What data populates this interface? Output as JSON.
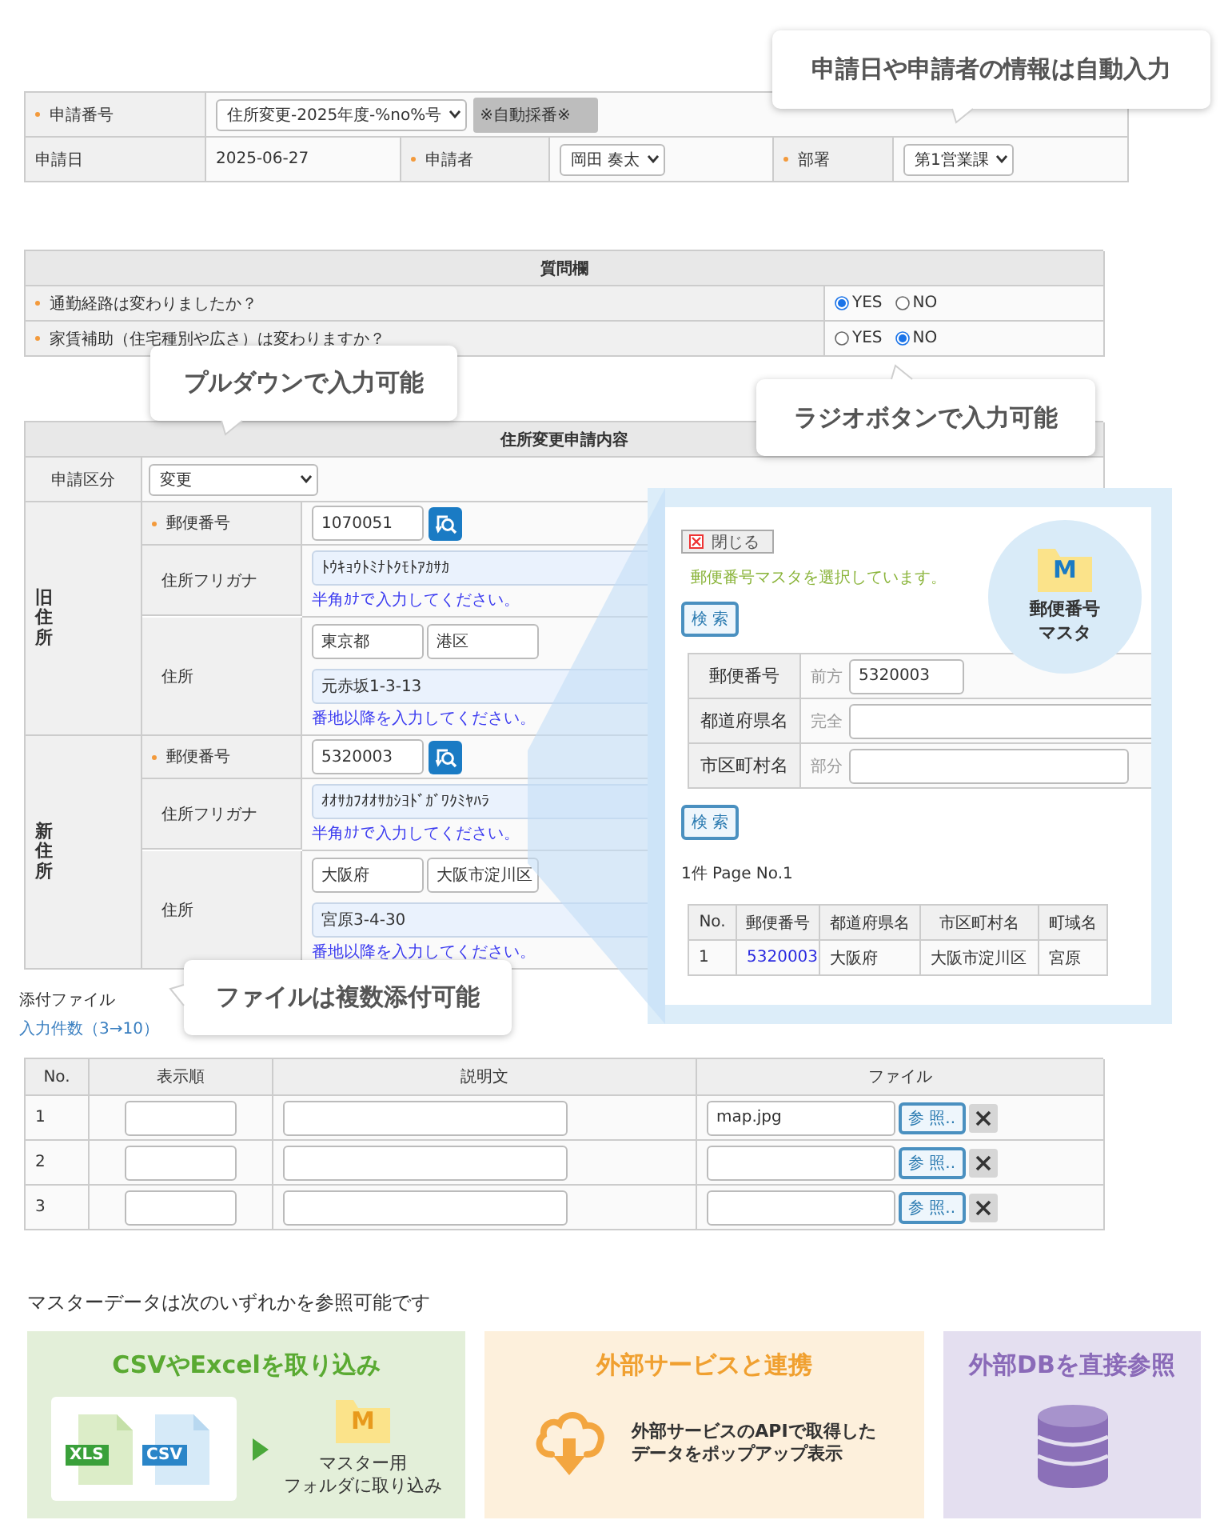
{
  "callouts": [
    {
      "text": "申請日や申請者の情報は自動入力"
    },
    {
      "text": "プルダウンで入力可能"
    },
    {
      "text": "ラジオボタンで入力可能"
    },
    {
      "text": "ファイルは複数添付可能"
    }
  ],
  "application": {
    "fields": [
      {
        "label": "申請番号",
        "required": true,
        "kind": "select",
        "value": "住所変更-2025年度-%no%号",
        "badge": "※自動採番※"
      },
      {
        "label": "申請日",
        "kind": "text",
        "value": "2025-06-27"
      },
      {
        "label": "申請者",
        "required": true,
        "kind": "select",
        "value": "岡田 奏太"
      },
      {
        "label": "部署",
        "required": true,
        "kind": "select",
        "value": "第1営業課"
      }
    ]
  },
  "questions": {
    "title": "質問欄",
    "items": [
      {
        "label": "通勤経路は変わりましたか？",
        "required": true,
        "options": [
          {
            "label": "YES",
            "selected": true
          },
          {
            "label": "NO",
            "selected": false
          }
        ]
      },
      {
        "label": "家賃補助（住宅種別や広さ）は変わりますか？",
        "required": true,
        "options": [
          {
            "label": "YES",
            "selected": false
          },
          {
            "label": "NO",
            "selected": true
          }
        ]
      }
    ]
  },
  "address_change": {
    "title": "住所変更申請内容",
    "category": {
      "label": "申請区分",
      "value": "変更"
    },
    "groups": [
      {
        "label": "旧住所",
        "postal": {
          "label": "郵便番号",
          "required": true,
          "value": "1070051"
        },
        "furigana": {
          "label": "住所フリガナ",
          "value": "ﾄｳｷｮｳﾄﾐﾅﾄｸﾓﾄｱｶｻｶ",
          "hint": "半角ｶﾅで入力してください。"
        },
        "address": {
          "label": "住所",
          "prefecture": "東京都",
          "city": "港区",
          "street": "元赤坂1-3-13",
          "hint": "番地以降を入力してください。"
        }
      },
      {
        "label": "新住所",
        "postal": {
          "label": "郵便番号",
          "required": true,
          "value": "5320003"
        },
        "furigana": {
          "label": "住所フリガナ",
          "value": "ｵｵｻｶﾌｵｵｻｶｼﾖﾄﾞｶﾞﾜｸﾐﾔﾊﾗ",
          "hint": "半角ｶﾅで入力してください。"
        },
        "address": {
          "label": "住所",
          "prefecture": "大阪府",
          "city": "大阪市淀川区",
          "street": "宮原3-4-30",
          "hint": "番地以降を入力してください。"
        }
      }
    ]
  },
  "postal_popup": {
    "close": "閉じる",
    "message": "郵便番号マスタを選択しています。",
    "search_buttons": [
      "検 索",
      "検 索"
    ],
    "badge": {
      "folder_letter": "M",
      "lines": [
        "郵便番号",
        "マスタ"
      ]
    },
    "criteria": [
      {
        "label": "郵便番号",
        "match": "前方",
        "value": "5320003"
      },
      {
        "label": "都道府県名",
        "match": "完全"
      },
      {
        "label": "市区町村名",
        "match": "部分"
      }
    ],
    "result_summary": "1件 Page No.1",
    "results": {
      "columns": [
        "No.",
        "郵便番号",
        "都道府県名",
        "市区町村名",
        "町域名"
      ],
      "rows": [
        [
          "1",
          "5320003",
          "大阪府",
          "大阪市淀川区",
          "宮原"
        ]
      ]
    }
  },
  "attachments": {
    "label": "添付ファイル",
    "count_link": "入力件数（3→10）",
    "columns": [
      "No.",
      "表示順",
      "説明文",
      "ファイル"
    ],
    "rows": [
      {
        "no": "1",
        "file": "map.jpg",
        "browse": "参 照.."
      },
      {
        "no": "2",
        "browse": "参 照.."
      },
      {
        "no": "3",
        "browse": "参 照.."
      }
    ]
  },
  "master_sources": {
    "title": "マスターデータは次のいずれかを参照可能です",
    "cards": [
      {
        "kind": "import",
        "title": "CSVやExcelを取り込み",
        "files": [
          "XLS",
          "CSV"
        ],
        "folder_letter": "M",
        "caption": [
          "マスター用",
          "フォルダに取り込み"
        ]
      },
      {
        "kind": "api",
        "title": "外部サービスと連携",
        "caption": [
          "外部サービスのAPIで取得した",
          "データをポップアップ表示"
        ]
      },
      {
        "kind": "database",
        "title": "外部DBを直接参照"
      }
    ]
  }
}
